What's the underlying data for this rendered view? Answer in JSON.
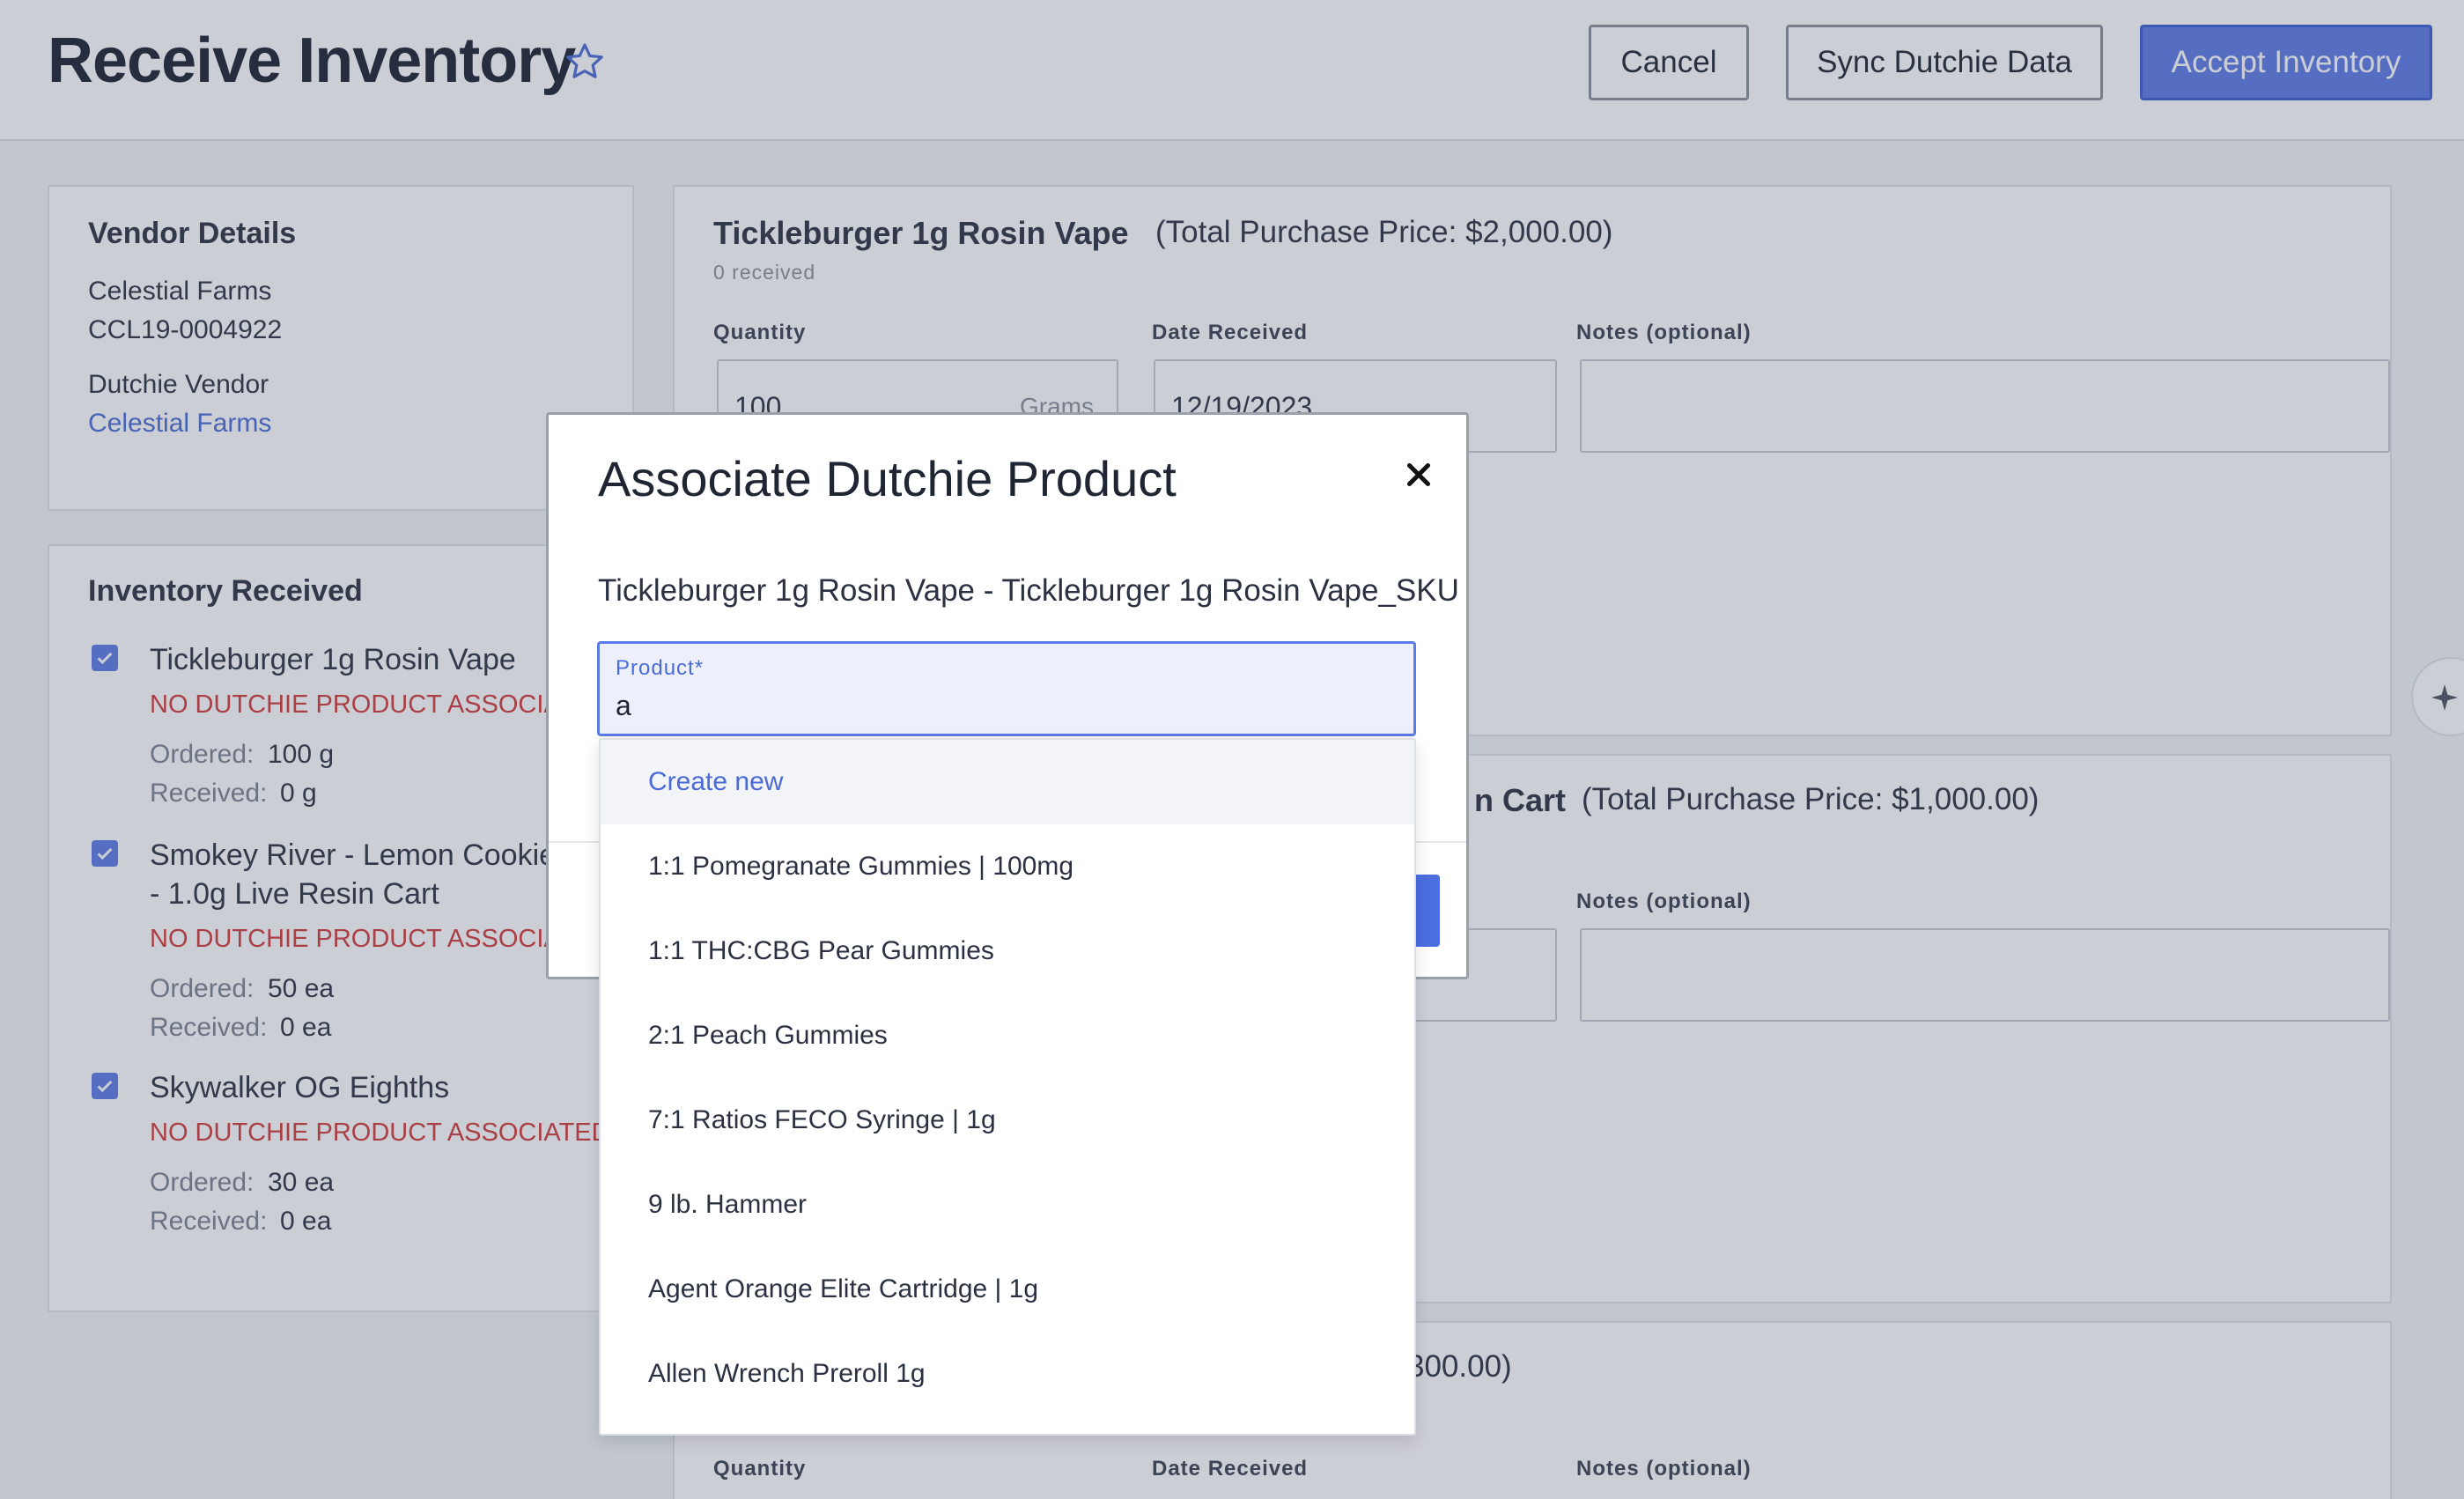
{
  "header": {
    "title": "Receive Inventory",
    "buttons": {
      "cancel": "Cancel",
      "sync": "Sync Dutchie Data",
      "accept": "Accept Inventory"
    }
  },
  "vendor": {
    "heading": "Vendor Details",
    "name": "Celestial Farms",
    "license": "CCL19-0004922",
    "dutchie_label": "Dutchie Vendor",
    "dutchie_vendor_link": "Celestial Farms"
  },
  "inventory": {
    "heading": "Inventory Received",
    "items": [
      {
        "name": "Tickleburger 1g Rosin Vape",
        "name2": "",
        "warning": "NO DUTCHIE PRODUCT ASSOCIA",
        "ordered_label": "Ordered:",
        "ordered": "100 g",
        "received_label": "Received:",
        "received": "0 g"
      },
      {
        "name": "Smokey River - Lemon Cookie",
        "name2": "- 1.0g Live Resin Cart",
        "warning": "NO DUTCHIE PRODUCT ASSOCIA",
        "ordered_label": "Ordered:",
        "ordered": "50 ea",
        "received_label": "Received:",
        "received": "0 ea"
      },
      {
        "name": "Skywalker OG Eighths",
        "name2": "",
        "warning": "NO DUTCHIE PRODUCT ASSOCIATED",
        "ordered_label": "Ordered:",
        "ordered": "30 ea",
        "received_label": "Received:",
        "received": "0 ea"
      }
    ]
  },
  "products": [
    {
      "title": "Tickleburger 1g Rosin Vape",
      "price": "(Total Purchase Price: $2,000.00)",
      "received": "0 received",
      "qty_label": "Quantity",
      "qty": "100",
      "unit": "Grams",
      "date_label": "Date Received",
      "date": "12/19/2023",
      "notes_label": "Notes (optional)"
    },
    {
      "title_fragment": "n Cart",
      "price": "(Total Purchase Price: $1,000.00)",
      "notes_label": "Notes (optional)"
    },
    {
      "price_fragment": "300.00)",
      "qty_label": "Quantity",
      "date_label": "Date Received",
      "notes_label": "Notes (optional)"
    }
  ],
  "modal": {
    "title": "Associate Dutchie Product",
    "subtitle": "Tickleburger 1g Rosin Vape - Tickleburger 1g Rosin Vape_SKU",
    "input_label": "Product*",
    "input_value": "a",
    "options": [
      "Create new",
      "1:1 Pomegranate Gummies | 100mg",
      "1:1 THC:CBG Pear Gummies",
      "2:1 Peach Gummies",
      "7:1 Ratios FECO Syringe | 1g",
      "9 lb. Hammer",
      "Agent Orange Elite Cartridge | 1g",
      "Allen Wrench Preroll 1g"
    ]
  },
  "colors": {
    "accent": "#5d7be6",
    "warning": "#d23a3a",
    "link": "#4a6bd6"
  },
  "icons": {
    "favorite": "star-icon",
    "close": "close-icon",
    "checkbox": "check-icon",
    "assistant": "sparkle-icon"
  }
}
